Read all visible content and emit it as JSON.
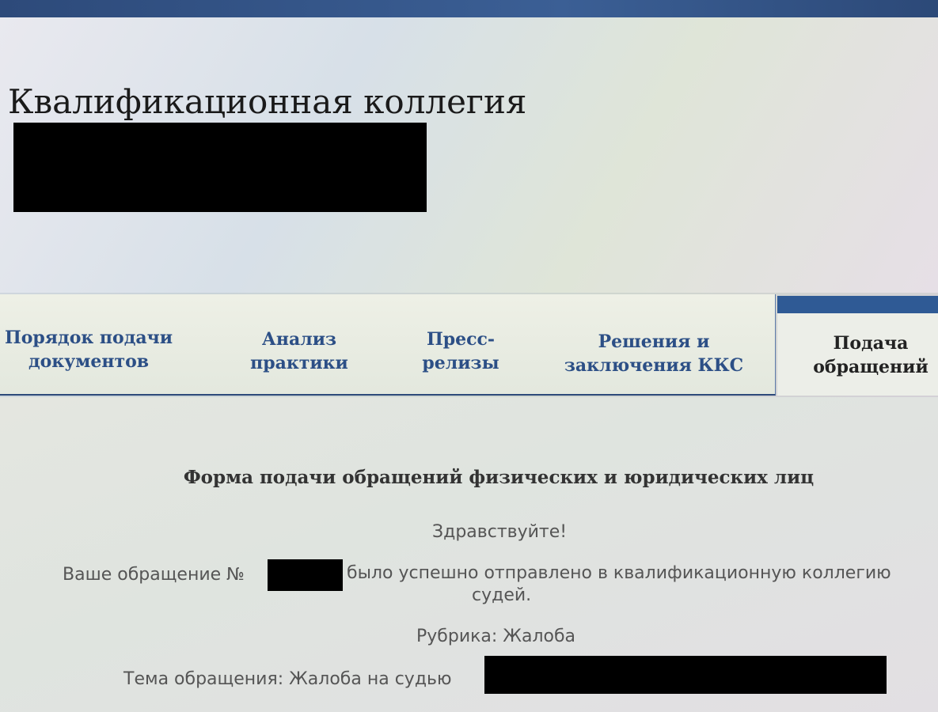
{
  "header": {
    "title": "Квалификационная коллегия"
  },
  "nav": {
    "tabs": [
      {
        "label_line1": "Порядок подачи",
        "label_line2": "документов"
      },
      {
        "label_line1": "Анализ",
        "label_line2": "практики"
      },
      {
        "label_line1": "Пресс-",
        "label_line2": "релизы"
      },
      {
        "label_line1": "Решения и",
        "label_line2": "заключения ККС"
      },
      {
        "label_line1": "Подача",
        "label_line2": "обращений",
        "active": true
      }
    ]
  },
  "main": {
    "form_title": "Форма подачи обращений физических и юридических лиц",
    "greeting": "Здравствуйте!",
    "message": {
      "prefix": "Ваше обращение №",
      "suffix": "было успешно отправлено в квалификационную коллегию",
      "line2": "судей."
    },
    "rubric": "Рубрика: Жалоба",
    "subject_prefix": "Тема обращения: Жалоба на судью"
  },
  "colors": {
    "nav_accent": "#2f5a95",
    "tab_text": "#2c4f86",
    "redaction": "#000000"
  }
}
